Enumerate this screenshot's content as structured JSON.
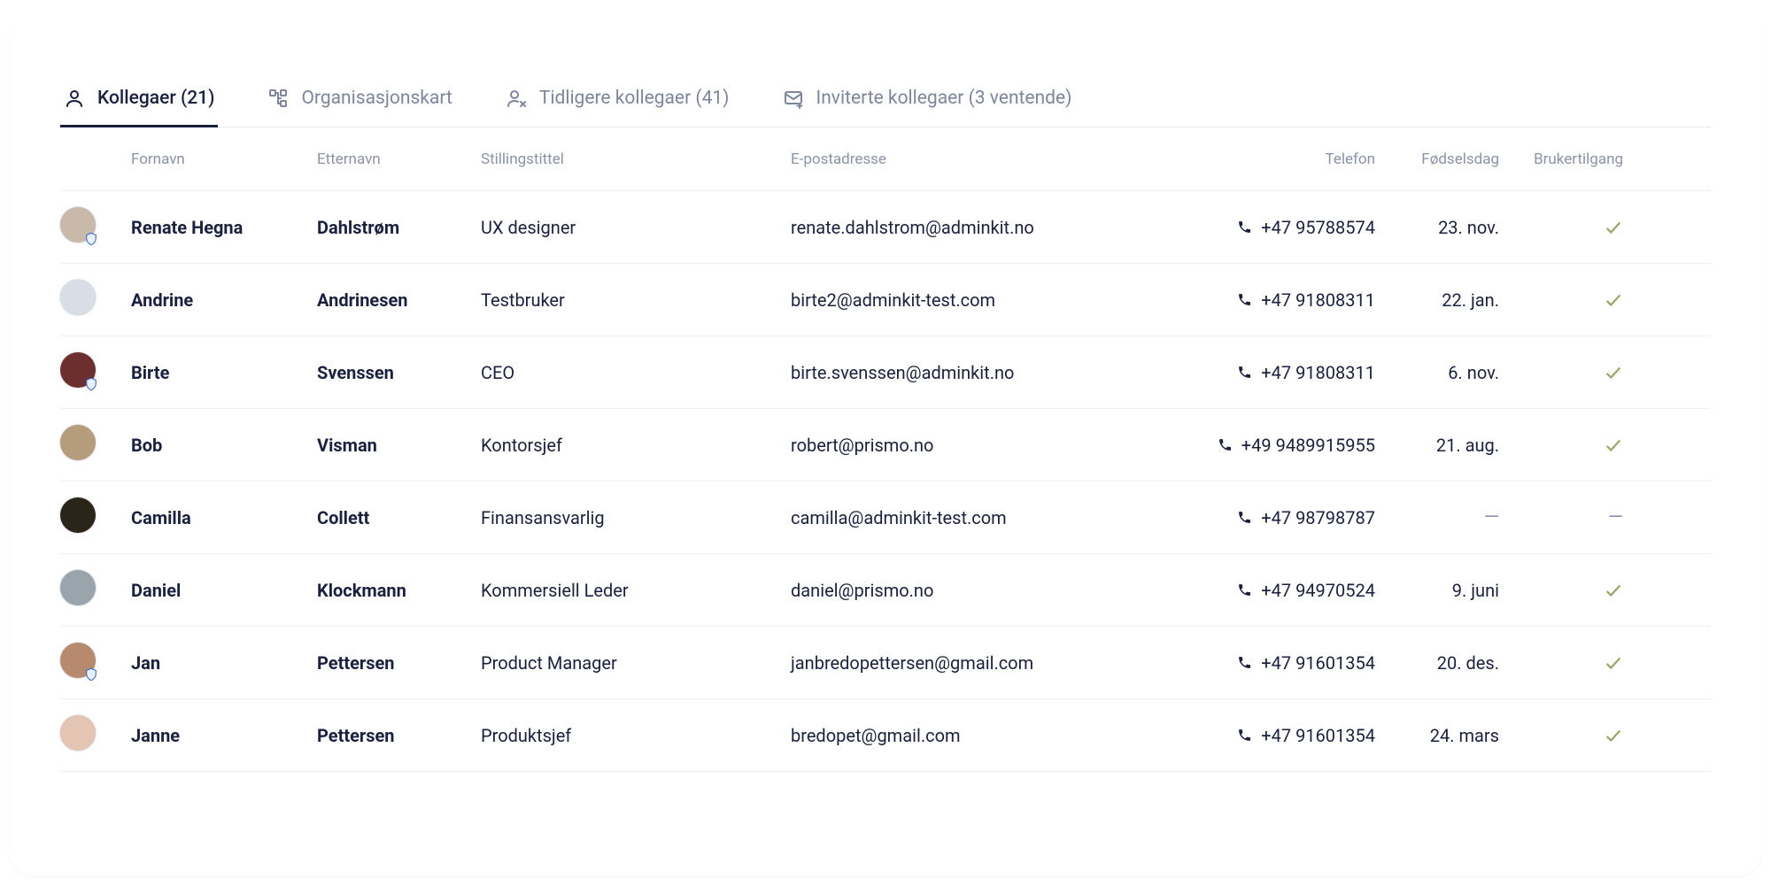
{
  "tabs": [
    {
      "label": "Kollegaer (21)",
      "icon": "person",
      "active": true
    },
    {
      "label": "Organisasjonskart",
      "icon": "org",
      "active": false
    },
    {
      "label": "Tidligere kollegaer (41)",
      "icon": "person-x",
      "active": false
    },
    {
      "label": "Inviterte kollegaer (3 ventende)",
      "icon": "mail-plus",
      "active": false
    }
  ],
  "columns": {
    "first": "Fornavn",
    "last": "Etternavn",
    "title": "Stillingstittel",
    "email": "E-postadresse",
    "phone": "Telefon",
    "birthday": "Fødselsdag",
    "access": "Brukertilgang"
  },
  "rows": [
    {
      "first": "Renate Hegna",
      "last": "Dahlstrøm",
      "title": "UX designer",
      "email": "renate.dahlstrom@adminkit.no",
      "phone": "+47 95788574",
      "birthday": "23. nov.",
      "access": "check",
      "avatar_color": "#c8b9a8",
      "badge": true
    },
    {
      "first": "Andrine",
      "last": "Andrinesen",
      "title": "Testbruker",
      "email": "birte2@adminkit-test.com",
      "phone": "+47 91808311",
      "birthday": "22. jan.",
      "access": "check",
      "avatar_color": "#d9dee6",
      "badge": false,
      "placeholder": true
    },
    {
      "first": "Birte",
      "last": "Svenssen",
      "title": "CEO",
      "email": "birte.svenssen@adminkit.no",
      "phone": "+47 91808311",
      "birthday": "6. nov.",
      "access": "check",
      "avatar_color": "#6d2e2e",
      "badge": true
    },
    {
      "first": "Bob",
      "last": "Visman",
      "title": "Kontorsjef",
      "email": "robert@prismo.no",
      "phone": "+49 9489915955",
      "birthday": "21. aug.",
      "access": "check",
      "avatar_color": "#b59d7c",
      "badge": false
    },
    {
      "first": "Camilla",
      "last": "Collett",
      "title": "Finansansvarlig",
      "email": "camilla@adminkit-test.com",
      "phone": "+47 98798787",
      "birthday": "—",
      "access": "dash",
      "avatar_color": "#2b2418",
      "badge": false
    },
    {
      "first": "Daniel",
      "last": "Klockmann",
      "title": "Kommersiell Leder",
      "email": "daniel@prismo.no",
      "phone": "+47 94970524",
      "birthday": "9. juni",
      "access": "check",
      "avatar_color": "#9aa4ad",
      "badge": false
    },
    {
      "first": "Jan",
      "last": "Pettersen",
      "title": "Product Manager",
      "email": "janbredopettersen@gmail.com",
      "phone": "+47 91601354",
      "birthday": "20. des.",
      "access": "check",
      "avatar_color": "#b78a6e",
      "badge": true
    },
    {
      "first": "Janne",
      "last": "Pettersen",
      "title": "Produktsjef",
      "email": "bredopet@gmail.com",
      "phone": "+47 91601354",
      "birthday": "24. mars",
      "access": "check",
      "avatar_color": "#e4c4b3",
      "badge": false
    }
  ]
}
